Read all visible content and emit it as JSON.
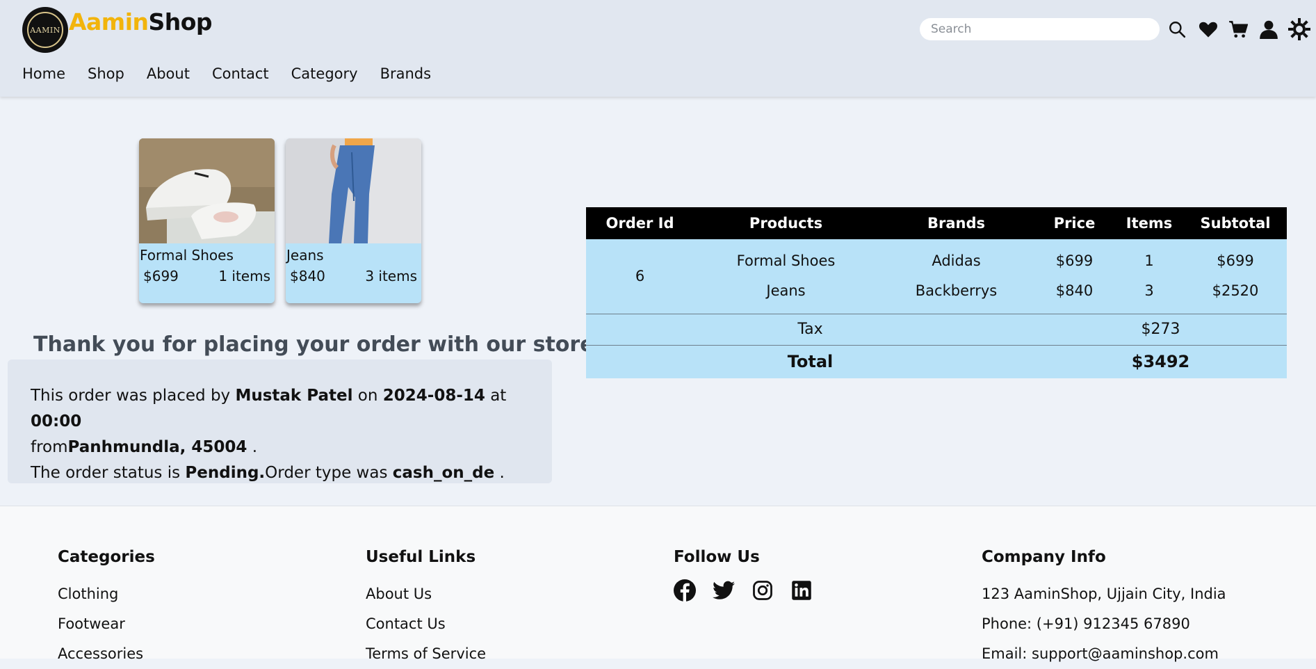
{
  "header": {
    "logo_text": "AAMIN",
    "brand_part1": "Aamin",
    "brand_part2": "Shop",
    "search_placeholder": "Search",
    "icons": [
      "search-icon",
      "heart-icon",
      "cart-icon",
      "user-icon",
      "theme-toggle-icon"
    ]
  },
  "nav": {
    "items": [
      "Home",
      "Shop",
      "About",
      "Contact",
      "Category",
      "Brands"
    ]
  },
  "cards": [
    {
      "name": "Formal Shoes",
      "price": "$699",
      "items": "1 items"
    },
    {
      "name": "Jeans",
      "price": "$840",
      "items": "3 items"
    }
  ],
  "thanks": "Thank you for placing your order with our store!",
  "order_info": {
    "t1": "This order was placed by",
    "customer": "Mustak Patel",
    "t2": "on",
    "date": "2024-08-14",
    "t3": "at",
    "time": "00:00",
    "t4": "from",
    "location": "Panhmundla, 45004",
    "t5": ".",
    "t6": "The order status is",
    "status": "Pending.",
    "t7": "Order type was",
    "order_type": "cash_on_de",
    "t8": "."
  },
  "order_table": {
    "headers": [
      "Order Id",
      "Products",
      "Brands",
      "Price",
      "Items",
      "Subtotal"
    ],
    "order_id": "6",
    "rows": [
      {
        "product": "Formal Shoes",
        "brand": "Adidas",
        "price": "$699",
        "items": "1",
        "subtotal": "$699"
      },
      {
        "product": "Jeans",
        "brand": "Backberrys",
        "price": "$840",
        "items": "3",
        "subtotal": "$2520"
      }
    ],
    "tax_label": "Tax",
    "tax_value": "$273",
    "total_label": "Total",
    "total_value": "$3492"
  },
  "footer": {
    "categories": {
      "title": "Categories",
      "items": [
        "Clothing",
        "Footwear",
        "Accessories"
      ]
    },
    "useful_links": {
      "title": "Useful Links",
      "items": [
        "About Us",
        "Contact Us",
        "Terms of Service"
      ]
    },
    "follow": {
      "title": "Follow Us",
      "icons": [
        "facebook-icon",
        "twitter-icon",
        "instagram-icon",
        "linkedin-icon"
      ]
    },
    "company": {
      "title": "Company Info",
      "items": [
        "123 AaminShop, Ujjain City, India",
        "Phone: (+91) 912345 67890",
        "Email: support@aaminshop.com"
      ]
    }
  },
  "colors": {
    "brand_accent": "#f2b40c",
    "header_bg": "#e1e7f0",
    "page_bg": "#eef2f8",
    "card_bg": "#b8e2f8",
    "table_header_bg": "#000000",
    "info_box_bg": "#e0e6ef"
  }
}
